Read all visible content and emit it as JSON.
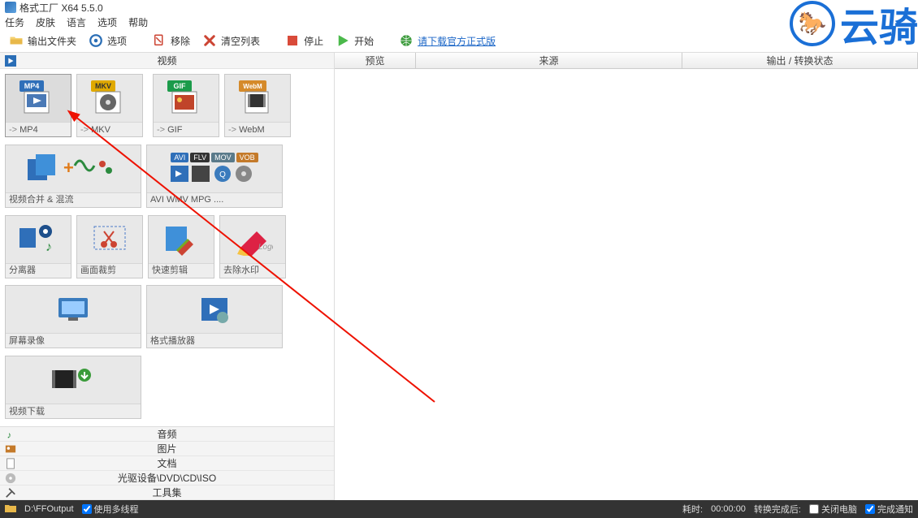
{
  "app": {
    "title": "格式工厂 X64 5.5.0"
  },
  "menu": {
    "task": "任务",
    "skin": "皮肤",
    "language": "语言",
    "options": "选项",
    "help": "帮助"
  },
  "toolbar": {
    "output": "输出文件夹",
    "options": "选项",
    "remove": "移除",
    "clear": "清空列表",
    "stop": "停止",
    "start": "开始",
    "download": "请下载官方正式版"
  },
  "sections": {
    "video": "视频",
    "audio": "音频",
    "image": "图片",
    "document": "文档",
    "drive": "光驱设备\\DVD\\CD\\ISO",
    "tools": "工具集"
  },
  "tiles": {
    "mp4": "MP4",
    "mkv": "MKV",
    "gif": "GIF",
    "webm": "WebM",
    "merge": "视频合并 & 混流",
    "more": "AVI WMV MPG ....",
    "splitter": "分离器",
    "crop": "画面裁剪",
    "quickedit": "快速剪辑",
    "delogo": "去除水印",
    "record": "屏幕录像",
    "player": "格式播放器",
    "download": "视频下载"
  },
  "tile_arrow": "->",
  "more_badges": {
    "avi": "AVI",
    "flv": "FLV",
    "mov": "MOV",
    "vob": "VOB"
  },
  "columns": {
    "preview": "预览",
    "source": "来源",
    "output": "输出 / 转换状态"
  },
  "status": {
    "output_path": "D:\\FFOutput",
    "multithread": "使用多线程",
    "elapsed_label": "耗时:",
    "elapsed": "00:00:00",
    "after_label": "转换完成后:",
    "shutdown": "关闭电脑",
    "notify": "完成通知"
  },
  "watermark": {
    "text": "云骑"
  }
}
